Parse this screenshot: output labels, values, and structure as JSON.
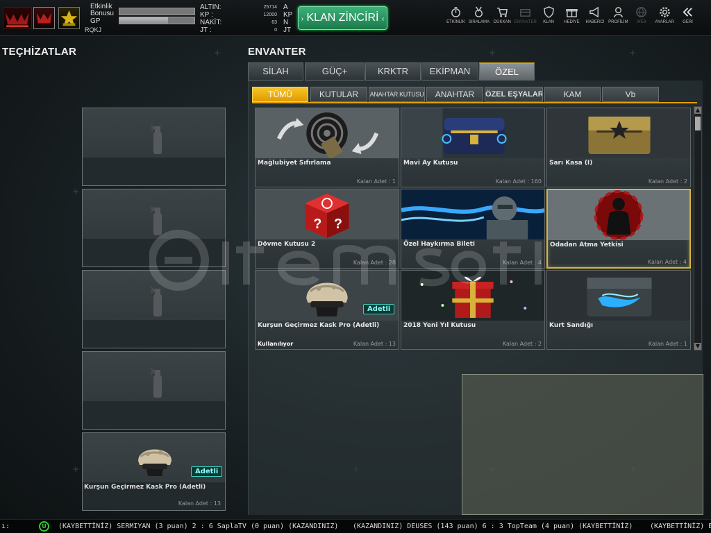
{
  "player": {
    "rank_label": "RQKJ",
    "etkinlik_bonusu_label": "Etkinlik\nBonusu",
    "gp_label": "GP",
    "etkinlik_bonus_progress": 0,
    "gp_progress": 0.65
  },
  "currency": [
    {
      "name": "ALTIN:",
      "value": "25714",
      "unit": "A"
    },
    {
      "name": "KP  :",
      "value": "12000",
      "unit": "KP"
    },
    {
      "name": "NAKİT:",
      "value": "63",
      "unit": "N"
    },
    {
      "name": "JT   :",
      "value": "0",
      "unit": "JT"
    }
  ],
  "klan_button": {
    "label": "KLAN ZİNCİRİ"
  },
  "topnav": [
    {
      "label": "ETKİNLİK",
      "icon": "stopwatch-icon",
      "enabled": true
    },
    {
      "label": "SIRALAMA",
      "icon": "medal-icon",
      "enabled": true
    },
    {
      "label": "DÜKKAN",
      "icon": "cart-icon",
      "enabled": true
    },
    {
      "label": "ENVANTER",
      "icon": "chest-icon",
      "enabled": false
    },
    {
      "label": "KLAN",
      "icon": "shield-icon",
      "enabled": true
    },
    {
      "label": "HEDİYE",
      "icon": "gift-icon",
      "enabled": true
    },
    {
      "label": "HABERCİ",
      "icon": "megaphone-icon",
      "enabled": true
    },
    {
      "label": "PROFİLİM",
      "icon": "user-icon",
      "enabled": true
    },
    {
      "label": "WEB",
      "icon": "globe-icon",
      "enabled": false
    },
    {
      "label": "AYARLAR",
      "icon": "gear-icon",
      "enabled": true
    },
    {
      "label": "GERİ",
      "icon": "back-icon",
      "enabled": true
    }
  ],
  "equipment": {
    "title": "TEÇHİZATLAR",
    "filled_slot": {
      "name": "Kurşun Geçirmez Kask Pro (Adetli)",
      "badge": "Adetli",
      "count": "Kalan Adet : 13"
    }
  },
  "inventory": {
    "title": "ENVANTER",
    "main_tabs": [
      "SİLAH",
      "GÜÇ+",
      "KRKTR",
      "EKİPMAN",
      "ÖZEL"
    ],
    "active_main_tab": 4,
    "sub_tabs": [
      "TÜMÜ",
      "KUTULAR",
      "ANAHTAR KUTUSU",
      "ANAHTAR",
      "ÖZEL EŞYALAR",
      "KAM",
      "Vb"
    ],
    "active_sub_tab": 0,
    "items": [
      {
        "name": "Mağlubiyet Sıfırlama",
        "count": "Kalan Adet : 1",
        "art": "target-icon"
      },
      {
        "name": "Mavi Ay Kutusu",
        "count": "Kalan Adet : 160",
        "art": "blue-chest-icon"
      },
      {
        "name": "Sarı Kasa (I)",
        "count": "Kalan Adet : 2",
        "art": "gold-chest-icon"
      },
      {
        "name": "Dövme Kutusu 2",
        "count": "Kalan Adet : 28",
        "art": "red-cube-icon"
      },
      {
        "name": "Özel Haykırma Bileti",
        "count": "Kalan Adet : 4",
        "art": "soldier-icon"
      },
      {
        "name": "Odadan Atma Yetkisi",
        "count": "Kalan Adet : 4",
        "art": "kick-icon",
        "selected": true
      },
      {
        "name": "Kurşun Geçirmez Kask Pro (Adetli)",
        "count": "Kalan Adet : 13",
        "art": "helmet-icon",
        "badge": "Adetli",
        "status": "Kullanılıyor"
      },
      {
        "name": "2018 Yeni Yıl Kutusu",
        "count": "Kalan Adet : 2",
        "art": "gift-box-icon"
      },
      {
        "name": "Kurt Sandığı",
        "count": "Kalan Adet : 1",
        "art": "wolf-chest-icon"
      }
    ]
  },
  "ticker": {
    "segments": [
      "(KAYBETTİNİZ) SERMIYAN (3 puan) 2 : 6 SaplaTV (0 puan) (KAZANDINIZ)",
      "(KAZANDINIZ) DEUSES (143 puan) 6 : 3 TopTeam (4 puan) (KAYBETTİNİZ)",
      "(KAYBETTİNİZ) E"
    ],
    "lead": "ı:"
  },
  "colors": {
    "accent": "#e0a000",
    "klan_green": "#2a9a62",
    "selected_border": "#d8b540"
  }
}
